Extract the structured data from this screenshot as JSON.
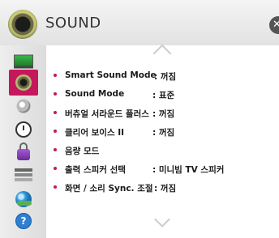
{
  "header": {
    "title": "SOUND",
    "icon": "speaker-icon",
    "close_label": "✕"
  },
  "sidebar": {
    "items": [
      {
        "name": "picture",
        "icon": "tv-picture-icon"
      },
      {
        "name": "sound",
        "icon": "speaker-icon",
        "active": true
      },
      {
        "name": "channel",
        "icon": "satellite-dish-icon"
      },
      {
        "name": "time",
        "icon": "clock-icon"
      },
      {
        "name": "lock",
        "icon": "padlock-icon"
      },
      {
        "name": "option",
        "icon": "option-icon"
      },
      {
        "name": "network",
        "icon": "globe-network-icon"
      },
      {
        "name": "support",
        "icon": "help-icon",
        "label": "?"
      }
    ]
  },
  "menu": {
    "items": [
      {
        "label": "Smart Sound Mode",
        "value": ": 꺼짐"
      },
      {
        "label": "Sound Mode",
        "value": ": 표준"
      },
      {
        "label": "버츄얼 서라운드 플러스",
        "value": ": 꺼짐"
      },
      {
        "label": "클리어 보이스 II",
        "value": ": 꺼짐"
      },
      {
        "label": "음량 모드",
        "value": ""
      },
      {
        "label": "출력 스피커 선택",
        "value": ": 미니빔 TV 스피커"
      },
      {
        "label": "화면 / 소리 Sync. 조절",
        "value": ": 꺼짐"
      }
    ]
  },
  "colors": {
    "accent": "#c5175c",
    "header_bg": "#e9e9e9",
    "sidebar_bg": "#e4e4e4"
  }
}
